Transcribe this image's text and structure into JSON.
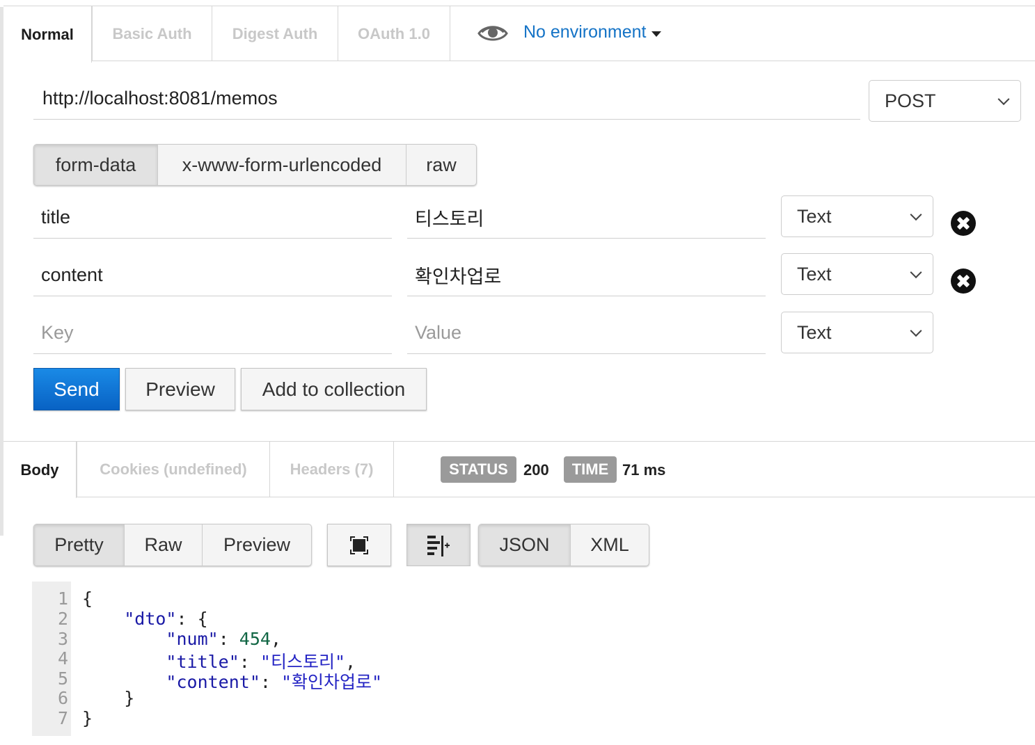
{
  "auth_tabs": [
    "Normal",
    "Basic Auth",
    "Digest Auth",
    "OAuth 1.0"
  ],
  "environment": {
    "label": "No environment",
    "icon": "eye-icon"
  },
  "request": {
    "url": "http://localhost:8081/memos",
    "method": "POST"
  },
  "body_modes": [
    "form-data",
    "x-www-form-urlencoded",
    "raw"
  ],
  "form_rows": [
    {
      "key": "title",
      "value": "티스토리",
      "type": "Text"
    },
    {
      "key": "content",
      "value": "확인차업로",
      "type": "Text"
    }
  ],
  "new_row": {
    "key_placeholder": "Key",
    "value_placeholder": "Value",
    "type": "Text"
  },
  "actions": {
    "send": "Send",
    "preview": "Preview",
    "add": "Add to collection"
  },
  "response_tabs": [
    "Body",
    "Cookies (undefined)",
    "Headers (7)"
  ],
  "status": {
    "label": "STATUS",
    "value": "200"
  },
  "time": {
    "label": "TIME",
    "value": "71 ms"
  },
  "view_modes": [
    "Pretty",
    "Raw",
    "Preview"
  ],
  "formats": [
    "JSON",
    "XML"
  ],
  "code": {
    "line_numbers": [
      "1",
      "2",
      "3",
      "4",
      "5",
      "6",
      "7"
    ],
    "dto_key": "\"dto\"",
    "num_key": "\"num\"",
    "num_val": "454",
    "title_key": "\"title\"",
    "title_val": "\"티스토리\"",
    "content_key": "\"content\"",
    "content_val": "\"확인차업로\""
  },
  "colors": {
    "accent": "#1473c6",
    "send_button": "#0a6fd4",
    "badge": "#9a9a9a"
  }
}
